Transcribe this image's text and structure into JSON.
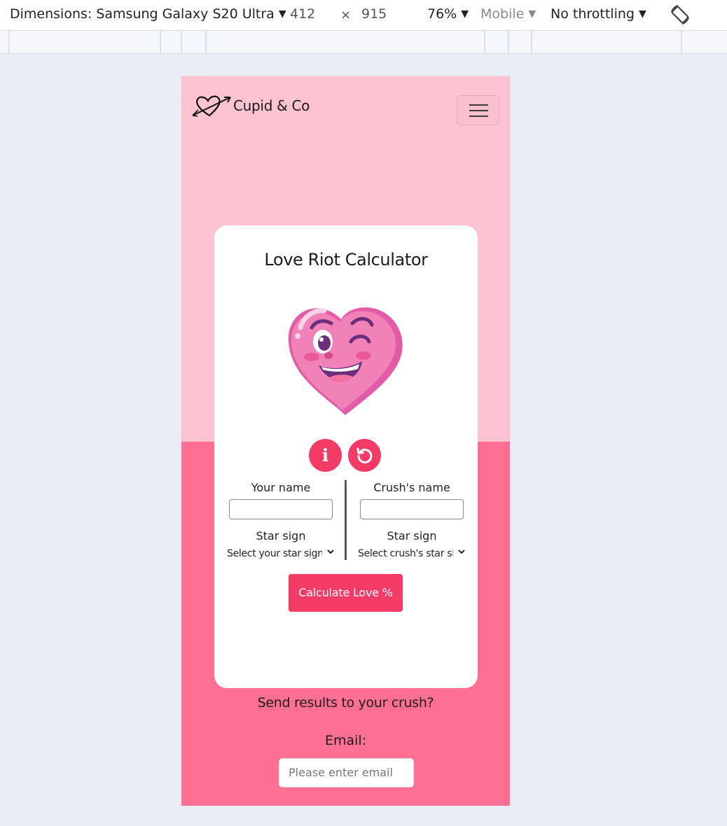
{
  "devtools": {
    "dimensions_label": "Dimensions: Samsung Galaxy S20 Ultra",
    "width": "412",
    "times": "×",
    "height": "915",
    "zoom": "76%",
    "device_type": "Mobile",
    "throttling": "No throttling",
    "caret": "▼",
    "rotate_icon": "rotate-icon"
  },
  "site": {
    "brand": "Cupid & Co",
    "brand_icon": "heart-arrow-logo",
    "menu_icon": "hamburger-icon"
  },
  "calculator": {
    "title": "Love Riot Calculator",
    "info_label": "i",
    "reset_icon": "reset-icon",
    "left": {
      "name_label": "Your name",
      "name_value": "",
      "star_label": "Star sign",
      "star_select": "Select your star sign"
    },
    "right": {
      "name_label": "Crush's name",
      "name_value": "",
      "star_label": "Star sign",
      "star_select": "Select crush's star sign"
    },
    "calculate_label": "Calculate Love %"
  },
  "email_section": {
    "prompt": "Send results to your crush?",
    "email_label": "Email:",
    "email_placeholder": "Please enter email"
  },
  "colors": {
    "page_top": "#fec3d0",
    "page_bottom": "#fe7093",
    "accent": "#f43b66"
  }
}
